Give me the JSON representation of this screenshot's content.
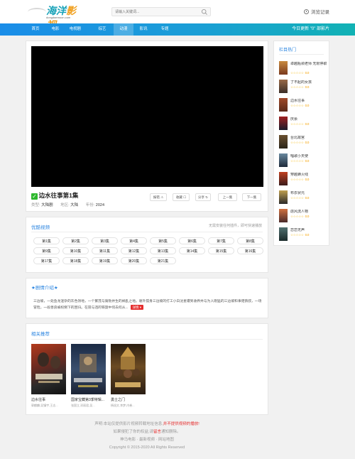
{
  "header": {
    "logo_text_a": "海洋",
    "logo_text_b": "影视",
    "logo_sub": "dongdaemoon.com",
    "search_placeholder": "请输入关键词...",
    "history_label": "浏览记录"
  },
  "nav": {
    "items": [
      "首页",
      "电影",
      "电视剧",
      "综艺",
      "动漫",
      "影讯",
      "专题"
    ],
    "active_index": 4,
    "update_text": "今日更新 \"0\" 部影片"
  },
  "player": {
    "title": "边水往事第1集",
    "type_label": "类型:",
    "type_value": "大陆剧",
    "region_label": "地区:",
    "region_value": "大陆",
    "year_label": "年份:",
    "year_value": "2024",
    "buttons": [
      "报错 ⚠",
      "收藏 ☐",
      "分享 ↻",
      "上一集",
      "下一集"
    ]
  },
  "episodes": {
    "title": "优酷视频",
    "note": "无需安装任何插件，即可快速播放",
    "items": [
      "第1集",
      "第2集",
      "第3集",
      "第4集",
      "第5集",
      "第6集",
      "第7集",
      "第8集",
      "第9集",
      "第10集",
      "第11集",
      "第12集",
      "第13集",
      "第14集",
      "第15集",
      "第16集",
      "第17集",
      "第18集",
      "第19集",
      "第20集",
      "第21集"
    ]
  },
  "intro": {
    "title": "★剧情介绍★",
    "text": "三边坡，一处鱼龙混杂的灰色领地，一个繁茂与腐败并生的祸乱之地。窘外孤身三边坡的打工小白沈星遭到收养并与为人刚猛的三边坡和事佬猜叔，一场冒险，一段善良被权倒下的回归。在冒与违的铁旋中何去何从...",
    "more_label": "详情 ▾"
  },
  "recommend": {
    "title": "相关推荐",
    "items": [
      {
        "name": "边水往事",
        "actor": "郭麒麟,吴镇宇,王志..."
      },
      {
        "name": "国家宝藏第3季特辑...",
        "actor": "张国立,邓丽君,吴..."
      },
      {
        "name": "勇士之门",
        "actor": "杨旭文,李梦,内卷..."
      }
    ]
  },
  "sidebar": {
    "title": "栏目热门",
    "items": [
      {
        "name": "卓越瓶颈老师 无限停职",
        "score": "0.0"
      },
      {
        "name": "了不起的女孩",
        "score": "0.0"
      },
      {
        "name": "边水往事",
        "score": "0.0"
      },
      {
        "name": "庆余",
        "score": "0.0"
      },
      {
        "name": "台北故宫",
        "score": "0.0"
      },
      {
        "name": "唱歌小天使",
        "score": "0.0"
      },
      {
        "name": "穿越蜂火线",
        "score": "0.0"
      },
      {
        "name": "布衣状元",
        "score": "0.0"
      },
      {
        "name": "虐风流人物",
        "score": "0.0"
      },
      {
        "name": "恋恋无声",
        "score": "0.0"
      }
    ]
  },
  "footer": {
    "line1_a": "声明:本站仅提供影片视频转载地址信息,",
    "line1_b": "并不提供视频的播放!",
    "line2_a": "如果侵犯了你的权益,请",
    "line2_link": "留言",
    "line2_b": "通知删除。",
    "line3": "神马电影 · 最新视频 · 网站地图",
    "line4": "Copyright © 2015-2020 All Rights Reserved"
  },
  "colors": {
    "accent": "#2a84e0",
    "nav_start": "#1a8de8",
    "nav_end": "#12b2b4",
    "star": "#f5b400",
    "red": "#e52e2e"
  }
}
